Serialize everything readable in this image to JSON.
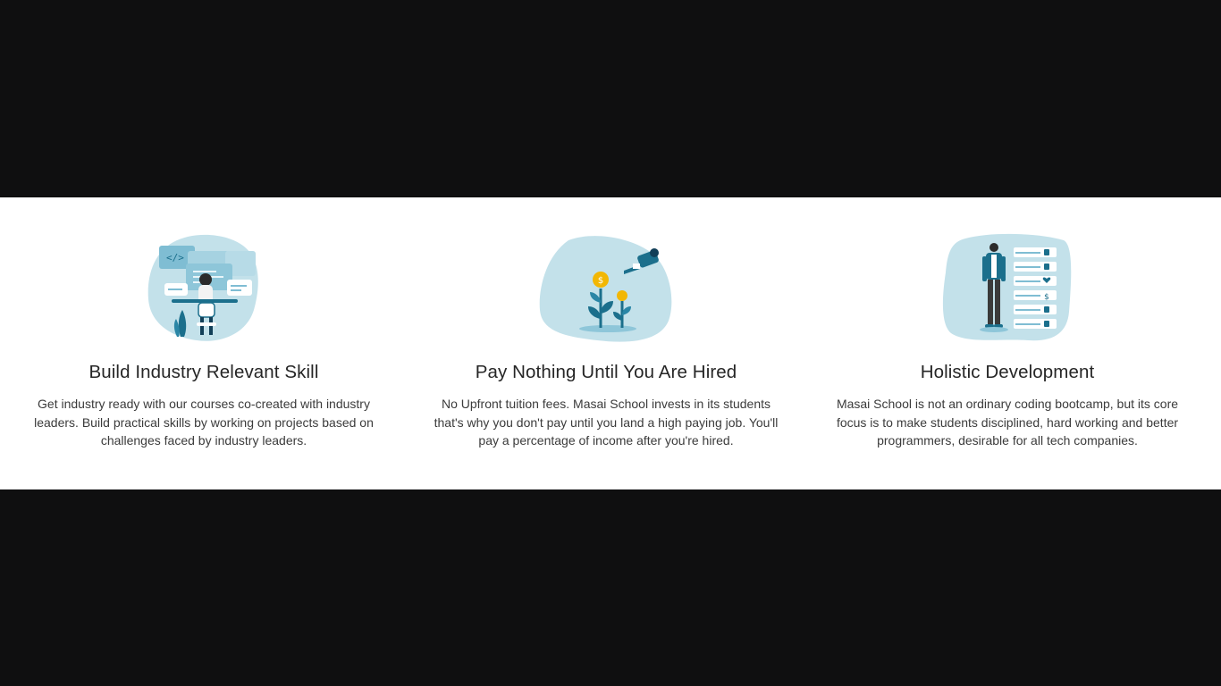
{
  "features": [
    {
      "title": "Build Industry Relevant Skill",
      "description": "Get industry ready with our courses co-created with industry leaders. Build practical skills by working on projects based on challenges faced by industry leaders.",
      "illustration": "developer-at-computer-illustration",
      "code_tag": "</>"
    },
    {
      "title": "Pay Nothing Until You Are Hired",
      "description": "No Upfront tuition fees. Masai School invests in its students that's why you don't pay until you land a high paying job. You'll pay a percentage of income after you're hired.",
      "illustration": "money-plant-watering-illustration",
      "coin_symbol": "$"
    },
    {
      "title": "Holistic Development",
      "description": "Masai School is not an ordinary coding bootcamp, but its core focus is to make students disciplined, hard working and better programmers, desirable for all tech companies.",
      "illustration": "person-with-skills-checklist-illustration",
      "list_symbol": "$"
    }
  ],
  "colors": {
    "blob": "#c3e1ea",
    "dark_teal": "#1b6f8c",
    "navy": "#123f58",
    "coin": "#f2b705",
    "band": "#0f0f10"
  }
}
